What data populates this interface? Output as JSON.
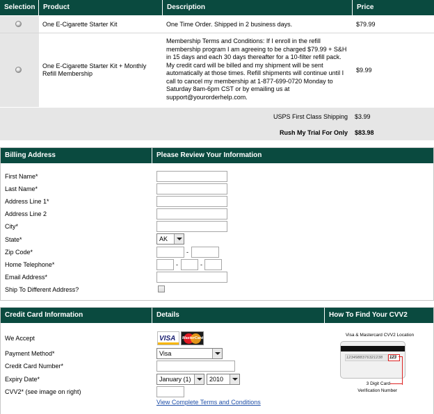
{
  "products": {
    "headers": [
      "Selection",
      "Product",
      "Description",
      "Price"
    ],
    "rows": [
      {
        "product": "One E-Cigarette Starter Kit",
        "description": "One Time Order. Shipped in 2 business days.",
        "price": "$79.99"
      },
      {
        "product": "One E-Cigarette Starter Kit + Monthly Refill Membership",
        "description": "Membership Terms and Conditions: If I enroll in the refill membership program I am agreeing to be charged $79.99 + S&H in 15 days and each 30 days thereafter for a 10-filter refill pack. My credit card will be billed and my shipment will be sent automatically at those times. Refill shipments will continue until I call to cancel my membership at 1-877-699-0720 Monday to Saturday 8am-6pm CST or by emailing us at support@yourorderhelp.com.",
        "price": "$9.99"
      }
    ],
    "shipping_label": "USPS First Class Shipping",
    "shipping_price": "$3.99",
    "total_label": "Rush My Trial For Only",
    "total_price": "$83.98"
  },
  "billing": {
    "header_left": "Billing Address",
    "header_right": "Please Review Your Information",
    "labels": {
      "first_name": "First Name*",
      "last_name": "Last Name*",
      "address1": "Address Line 1*",
      "address2": "Address Line 2",
      "city": "City*",
      "state": "State*",
      "zip": "Zip Code*",
      "phone": "Home Telephone*",
      "email": "Email Address*",
      "ship_diff": "Ship To Different Address?"
    },
    "state_value": "AK"
  },
  "payment": {
    "header_left": "Credit Card Information",
    "header_mid": "Details",
    "header_right": "How To Find Your CVV2",
    "labels": {
      "we_accept": "We Accept",
      "method": "Payment Method*",
      "card_number": "Credit Card Number*",
      "expiry": "Expiry Date*",
      "cvv": "CVV2* (see image on right)"
    },
    "method_value": "Visa",
    "expiry_month": "January (1)",
    "expiry_year": "2010",
    "terms_link": "View Complete Terms and Conditions",
    "card_logos": [
      "VISA",
      "MasterCard"
    ],
    "cvv_image": {
      "title": "Visa & Mastercard CVV2 Location",
      "number": "1234988376321238",
      "code": "123",
      "caption_line1": "3 Digit Card",
      "caption_line2": "Verification Number"
    }
  },
  "colors": {
    "header_bg": "#0a4a3f",
    "row_muted": "#e6e6e6",
    "link": "#1f4fa8"
  }
}
